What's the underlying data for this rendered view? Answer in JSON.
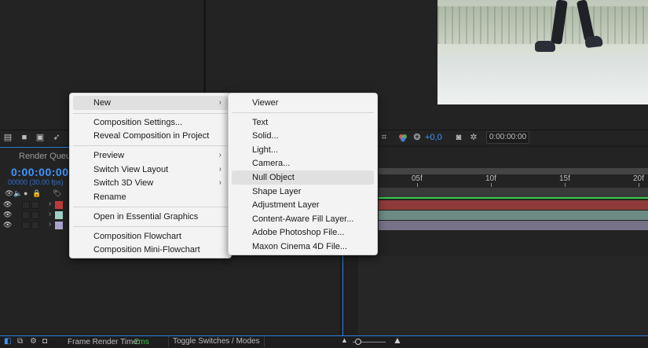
{
  "toolbar": {
    "plus_value": "+0,0",
    "timecode": "0:00:00:00",
    "colors": {
      "accent": "#3e96ff",
      "green": "#37c94a"
    }
  },
  "timeline": {
    "render_queue_tab": "Render Queue",
    "current_time": "0:00:00:00",
    "frames_fps": "00000 (30.00 fps)",
    "ruler_labels": [
      "05f",
      "10f",
      "15f",
      "20f"
    ],
    "layers": [
      {
        "label_color": "#c0393a",
        "track_color": "#8e3a3a"
      },
      {
        "label_color": "#9fd0c6",
        "track_color": "#6d8a84"
      },
      {
        "label_color": "#a9a4cc",
        "track_color": "#777288"
      }
    ]
  },
  "status_bar": {
    "frame_render_label": "Frame Render Time:",
    "frame_render_value": "2ms",
    "toggle_label": "Toggle Switches / Modes"
  },
  "context_menu": {
    "items": [
      {
        "label": "New",
        "has_submenu": true,
        "highlighted": true
      },
      {
        "label": "Composition Settings..."
      },
      {
        "label": "Reveal Composition in Project"
      },
      {
        "label": "Preview",
        "has_submenu": true
      },
      {
        "label": "Switch View Layout",
        "has_submenu": true
      },
      {
        "label": "Switch 3D View",
        "has_submenu": true
      },
      {
        "label": "Rename"
      },
      {
        "label": "Open in Essential Graphics"
      },
      {
        "label": "Composition Flowchart"
      },
      {
        "label": "Composition Mini-Flowchart"
      }
    ]
  },
  "submenu_new": {
    "items": [
      {
        "label": "Viewer"
      },
      {
        "label": "Text"
      },
      {
        "label": "Solid..."
      },
      {
        "label": "Light..."
      },
      {
        "label": "Camera..."
      },
      {
        "label": "Null Object",
        "highlighted": true
      },
      {
        "label": "Shape Layer"
      },
      {
        "label": "Adjustment Layer"
      },
      {
        "label": "Content-Aware Fill Layer..."
      },
      {
        "label": "Adobe Photoshop File..."
      },
      {
        "label": "Maxon Cinema 4D File..."
      }
    ]
  }
}
